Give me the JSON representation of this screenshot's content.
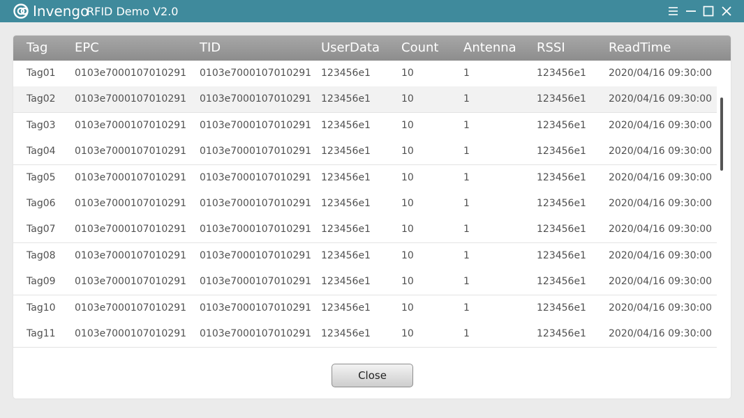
{
  "window": {
    "brand": "Invengo",
    "title": "RFID Demo V2.0",
    "title_bar_color": "#3f8a9c",
    "controls": [
      "menu-icon",
      "minimize-icon",
      "maximize-icon",
      "close-icon"
    ]
  },
  "table": {
    "header_color": "#9a9a9a",
    "columns": [
      "Tag",
      "EPC",
      "TID",
      "UserData",
      "Count",
      "Antenna",
      "RSSI",
      "ReadTime"
    ],
    "rows": [
      [
        "Tag01",
        "0103e7000107010291",
        "0103e7000107010291",
        "123456e1",
        "10",
        "1",
        "123456e1",
        "2020/04/16 09:30:00"
      ],
      [
        "Tag02",
        "0103e7000107010291",
        "0103e7000107010291",
        "123456e1",
        "10",
        "1",
        "123456e1",
        "2020/04/16 09:30:00"
      ],
      [
        "Tag03",
        "0103e7000107010291",
        "0103e7000107010291",
        "123456e1",
        "10",
        "1",
        "123456e1",
        "2020/04/16 09:30:00"
      ],
      [
        "Tag04",
        "0103e7000107010291",
        "0103e7000107010291",
        "123456e1",
        "10",
        "1",
        "123456e1",
        "2020/04/16 09:30:00"
      ],
      [
        "Tag05",
        "0103e7000107010291",
        "0103e7000107010291",
        "123456e1",
        "10",
        "1",
        "123456e1",
        "2020/04/16 09:30:00"
      ],
      [
        "Tag06",
        "0103e7000107010291",
        "0103e7000107010291",
        "123456e1",
        "10",
        "1",
        "123456e1",
        "2020/04/16 09:30:00"
      ],
      [
        "Tag07",
        "0103e7000107010291",
        "0103e7000107010291",
        "123456e1",
        "10",
        "1",
        "123456e1",
        "2020/04/16 09:30:00"
      ],
      [
        "Tag08",
        "0103e7000107010291",
        "0103e7000107010291",
        "123456e1",
        "10",
        "1",
        "123456e1",
        "2020/04/16 09:30:00"
      ],
      [
        "Tag09",
        "0103e7000107010291",
        "0103e7000107010291",
        "123456e1",
        "10",
        "1",
        "123456e1",
        "2020/04/16 09:30:00"
      ],
      [
        "Tag10",
        "0103e7000107010291",
        "0103e7000107010291",
        "123456e1",
        "10",
        "1",
        "123456e1",
        "2020/04/16 09:30:00"
      ],
      [
        "Tag11",
        "0103e7000107010291",
        "0103e7000107010291",
        "123456e1",
        "10",
        "1",
        "123456e1",
        "2020/04/16 09:30:00"
      ]
    ],
    "highlighted_row": 1
  },
  "footer": {
    "close_label": "Close"
  }
}
